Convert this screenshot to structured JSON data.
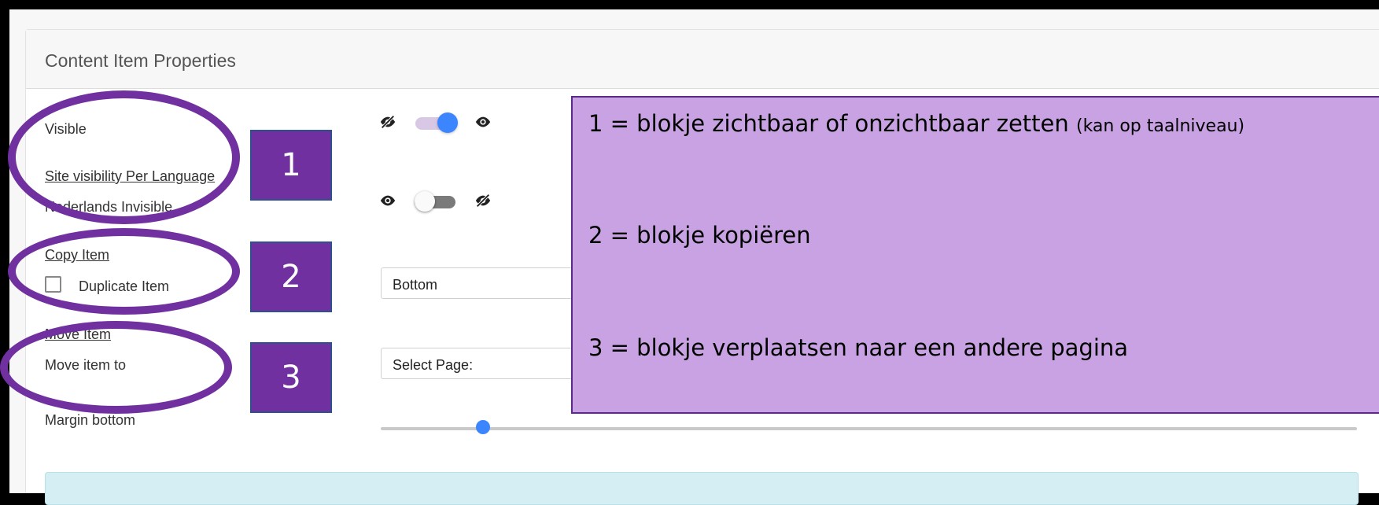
{
  "card": {
    "title": "Content Item Properties"
  },
  "fields": {
    "visible_label": "Visible",
    "site_visibility_link": "Site visibility Per Language",
    "language_label": "Nederlands Invisible",
    "copy_item_link": "Copy Item",
    "duplicate_label": "Duplicate Item",
    "move_item_link": "Move Item",
    "move_to_label": "Move item to",
    "margin_label": "Margin bottom"
  },
  "controls": {
    "visible_toggle": {
      "state": "on",
      "color_on": "#3b86ff"
    },
    "language_toggle": {
      "state": "off"
    },
    "position_select": {
      "selected": "Bottom"
    },
    "page_select": {
      "selected": "Select Page:"
    },
    "margin_slider": {
      "value_fraction": 0.1
    },
    "duplicate_checkbox": {
      "checked": false
    }
  },
  "icons": {
    "hidden": "eye-slash-icon",
    "shown": "eye-icon"
  },
  "annotations": {
    "markers": [
      "1",
      "2",
      "3"
    ],
    "callout": {
      "line1_main": "1 = blokje zichtbaar of onzichtbaar zetten",
      "line1_note": "(kan op taalniveau)",
      "line2": "2 = blokje kopiëren",
      "line3": "3 = blokje verplaatsen naar een andere pagina"
    },
    "accent_color": "#7030a0",
    "callout_color": "#c8a2e3"
  }
}
